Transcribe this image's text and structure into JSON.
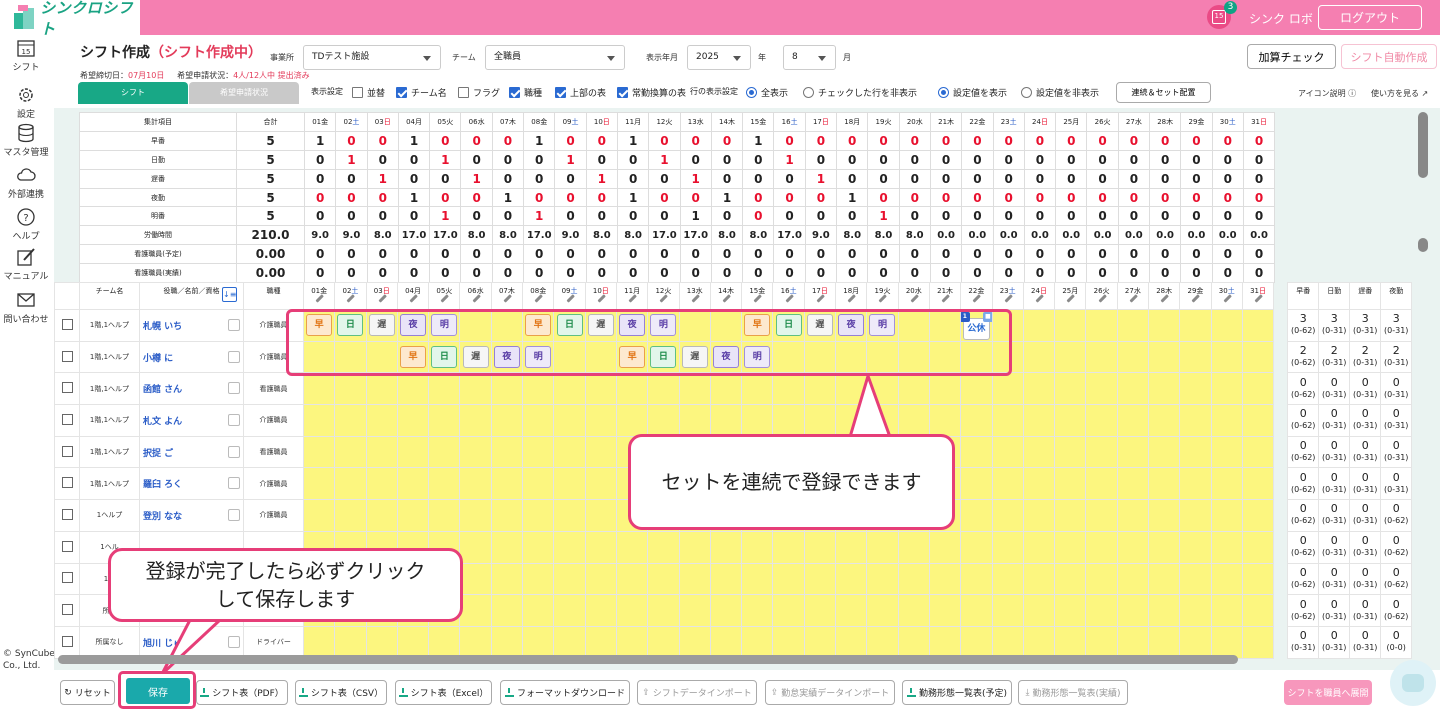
{
  "header": {
    "logo": "シンクロシフト",
    "notification_count": "3",
    "calendar_day": "15",
    "user": "シンク ロボ",
    "logout": "ログアウト"
  },
  "sidebar": [
    {
      "label": "シフト",
      "icon": "calendar-icon"
    },
    {
      "label": "設定",
      "icon": "gear-icon"
    },
    {
      "label": "マスタ管理",
      "icon": "database-icon"
    },
    {
      "label": "外部連携",
      "icon": "cloud-icon"
    },
    {
      "label": "ヘルプ",
      "icon": "help-icon"
    },
    {
      "label": "マニュアル",
      "icon": "edit-icon"
    },
    {
      "label": "問い合わせ",
      "icon": "mail-icon"
    }
  ],
  "copyright": [
    "© SynCube",
    "Co., Ltd."
  ],
  "page": {
    "title": "シフト作成",
    "mode": "（シフト作成中）",
    "deadline_label": "希望締切日：",
    "deadline_value": "07月10日",
    "apply_label": "希望申請状況：",
    "apply_value": "4人/12人中 提出済み"
  },
  "filters": {
    "facility_label": "事業所",
    "facility": "TDテスト施設",
    "team_label": "チーム",
    "team": "全職員",
    "period_label": "表示年月",
    "year": "2025",
    "year_unit": "年",
    "month": "8",
    "month_unit": "月"
  },
  "actions": {
    "calc_check": "加算チェック",
    "auto_create": "シフト自動作成"
  },
  "tabs": {
    "shift": "シフト",
    "request": "希望申請状況"
  },
  "display": {
    "label": "表示設定",
    "options": [
      {
        "label": "並替",
        "checked": false
      },
      {
        "label": "チーム名",
        "checked": true
      },
      {
        "label": "フラグ",
        "checked": false
      },
      {
        "label": "職種",
        "checked": true
      },
      {
        "label": "上部の表",
        "checked": true
      },
      {
        "label": "常勤換算の表",
        "checked": true
      }
    ],
    "row_label": "行の表示設定",
    "row_options": [
      {
        "label": "全表示",
        "checked": true
      },
      {
        "label": "チェックした行を非表示",
        "checked": false
      }
    ],
    "value_options": [
      {
        "label": "設定値を表示",
        "checked": true
      },
      {
        "label": "設定値を非表示",
        "checked": false
      }
    ],
    "chain_button": "連続＆セット配置",
    "icon_help": "アイコン説明",
    "how_to": "使い方を見る"
  },
  "days": [
    {
      "n": "01",
      "w": "金"
    },
    {
      "n": "02",
      "w": "土"
    },
    {
      "n": "03",
      "w": "日"
    },
    {
      "n": "04",
      "w": "月"
    },
    {
      "n": "05",
      "w": "火"
    },
    {
      "n": "06",
      "w": "水"
    },
    {
      "n": "07",
      "w": "木"
    },
    {
      "n": "08",
      "w": "金"
    },
    {
      "n": "09",
      "w": "土"
    },
    {
      "n": "10",
      "w": "日"
    },
    {
      "n": "11",
      "w": "月"
    },
    {
      "n": "12",
      "w": "火"
    },
    {
      "n": "13",
      "w": "水"
    },
    {
      "n": "14",
      "w": "木"
    },
    {
      "n": "15",
      "w": "金"
    },
    {
      "n": "16",
      "w": "土"
    },
    {
      "n": "17",
      "w": "日"
    },
    {
      "n": "18",
      "w": "月"
    },
    {
      "n": "19",
      "w": "火"
    },
    {
      "n": "20",
      "w": "水"
    },
    {
      "n": "21",
      "w": "木"
    },
    {
      "n": "22",
      "w": "金"
    },
    {
      "n": "23",
      "w": "土"
    },
    {
      "n": "24",
      "w": "日"
    },
    {
      "n": "25",
      "w": "月"
    },
    {
      "n": "26",
      "w": "火"
    },
    {
      "n": "27",
      "w": "水"
    },
    {
      "n": "28",
      "w": "木"
    },
    {
      "n": "29",
      "w": "金"
    },
    {
      "n": "30",
      "w": "土"
    },
    {
      "n": "31",
      "w": "日"
    }
  ],
  "summary": {
    "header_label": "集計項目",
    "total_label": "合計",
    "rows": [
      {
        "label": "早番",
        "total": "5",
        "type": "count",
        "values": [
          1,
          0,
          0,
          1,
          0,
          0,
          0,
          1,
          0,
          0,
          1,
          0,
          0,
          0,
          1,
          0,
          0,
          0,
          0,
          0,
          0,
          0,
          0,
          0,
          0,
          0,
          0,
          0,
          0,
          0,
          0
        ],
        "red": [
          2,
          3,
          5,
          6,
          7,
          9,
          10,
          12,
          13,
          14,
          16,
          17,
          18,
          19,
          20,
          21,
          22,
          23,
          24,
          25,
          26,
          27,
          28,
          29,
          30,
          31
        ]
      },
      {
        "label": "日勤",
        "total": "5",
        "type": "count",
        "values": [
          0,
          1,
          0,
          0,
          1,
          0,
          0,
          0,
          1,
          0,
          0,
          1,
          0,
          0,
          0,
          1,
          0,
          0,
          0,
          0,
          0,
          0,
          0,
          0,
          0,
          0,
          0,
          0,
          0,
          0,
          0
        ],
        "red": [
          2,
          5,
          9,
          12,
          16
        ]
      },
      {
        "label": "遅番",
        "total": "5",
        "type": "count",
        "values": [
          0,
          0,
          1,
          0,
          0,
          1,
          0,
          0,
          0,
          1,
          0,
          0,
          1,
          0,
          0,
          0,
          1,
          0,
          0,
          0,
          0,
          0,
          0,
          0,
          0,
          0,
          0,
          0,
          0,
          0,
          0
        ],
        "red": [
          3,
          6,
          10,
          13,
          17
        ]
      },
      {
        "label": "夜勤",
        "total": "5",
        "type": "count",
        "values": [
          0,
          0,
          0,
          1,
          0,
          0,
          1,
          0,
          0,
          0,
          1,
          0,
          0,
          1,
          0,
          0,
          0,
          1,
          0,
          0,
          0,
          0,
          0,
          0,
          0,
          0,
          0,
          0,
          0,
          0,
          0
        ],
        "red": [
          1,
          2,
          3,
          5,
          6,
          8,
          9,
          10,
          12,
          13,
          15,
          16,
          17,
          19,
          20,
          21,
          22,
          23,
          24,
          25,
          26,
          27,
          28,
          29,
          30,
          31
        ]
      },
      {
        "label": "明番",
        "total": "5",
        "type": "count",
        "values": [
          0,
          0,
          0,
          0,
          1,
          0,
          0,
          1,
          0,
          0,
          0,
          0,
          1,
          0,
          0,
          0,
          0,
          0,
          1,
          0,
          0,
          0,
          0,
          0,
          0,
          0,
          0,
          0,
          0,
          0,
          0
        ],
        "red": [
          5,
          8,
          15,
          19
        ]
      },
      {
        "label": "労働時間",
        "total": "210.0",
        "type": "hours",
        "values": [
          "9.0",
          "9.0",
          "8.0",
          "17.0",
          "17.0",
          "8.0",
          "8.0",
          "17.0",
          "9.0",
          "8.0",
          "8.0",
          "17.0",
          "17.0",
          "8.0",
          "8.0",
          "17.0",
          "9.0",
          "8.0",
          "8.0",
          "8.0",
          "0.0",
          "0.0",
          "0.0",
          "0.0",
          "0.0",
          "0.0",
          "0.0",
          "0.0",
          "0.0",
          "0.0",
          "0.0"
        ],
        "red": []
      },
      {
        "label": "看護職員(予定)",
        "total": "0.00",
        "type": "count",
        "values": [
          0,
          0,
          0,
          0,
          0,
          0,
          0,
          0,
          0,
          0,
          0,
          0,
          0,
          0,
          0,
          0,
          0,
          0,
          0,
          0,
          0,
          0,
          0,
          0,
          0,
          0,
          0,
          0,
          0,
          0,
          0
        ],
        "red": []
      },
      {
        "label": "看護職員(実績)",
        "total": "0.00",
        "type": "count",
        "values": [
          0,
          0,
          0,
          0,
          0,
          0,
          0,
          0,
          0,
          0,
          0,
          0,
          0,
          0,
          0,
          0,
          0,
          0,
          0,
          0,
          0,
          0,
          0,
          0,
          0,
          0,
          0,
          0,
          0,
          0,
          0
        ],
        "red": []
      }
    ]
  },
  "staff_header": {
    "team": "チーム名",
    "name": "役職／名前／資格",
    "job": "職種",
    "counts": [
      "早番",
      "日勤",
      "遅番",
      "夜勤"
    ]
  },
  "staff": [
    {
      "team": "1階,1ヘルプ",
      "name": "札幌 いち",
      "job": "介護職員",
      "shifts": {
        "1": "早",
        "2": "日",
        "3": "遅",
        "4": "夜",
        "5": "明",
        "8": "早",
        "9": "日",
        "10": "遅",
        "11": "夜",
        "12": "明",
        "15": "早",
        "16": "日",
        "17": "遅",
        "18": "夜",
        "19": "明",
        "22": "公休"
      },
      "counts": [
        [
          "3",
          "(0-62)"
        ],
        [
          "3",
          "(0-31)"
        ],
        [
          "3",
          "(0-31)"
        ],
        [
          "3",
          "(0-31)"
        ]
      ]
    },
    {
      "team": "1階,1ヘルプ",
      "name": "小樽 に",
      "job": "介護職員",
      "shifts": {
        "4": "早",
        "5": "日",
        "6": "遅",
        "7": "夜",
        "8": "明",
        "11": "早",
        "12": "日",
        "13": "遅",
        "14": "夜",
        "15": "明"
      },
      "counts": [
        [
          "2",
          "(0-62)"
        ],
        [
          "2",
          "(0-31)"
        ],
        [
          "2",
          "(0-31)"
        ],
        [
          "2",
          "(0-31)"
        ]
      ]
    },
    {
      "team": "1階,1ヘルプ",
      "name": "函館 さん",
      "job": "看護職員",
      "shifts": {},
      "counts": [
        [
          "0",
          "(0-62)"
        ],
        [
          "0",
          "(0-31)"
        ],
        [
          "0",
          "(0-31)"
        ],
        [
          "0",
          "(0-31)"
        ]
      ]
    },
    {
      "team": "1階,1ヘルプ",
      "name": "札文 よん",
      "job": "介護職員",
      "shifts": {},
      "counts": [
        [
          "0",
          "(0-62)"
        ],
        [
          "0",
          "(0-31)"
        ],
        [
          "0",
          "(0-31)"
        ],
        [
          "0",
          "(0-31)"
        ]
      ]
    },
    {
      "team": "1階,1ヘルプ",
      "name": "択捉 ご",
      "job": "看護職員",
      "shifts": {},
      "counts": [
        [
          "0",
          "(0-62)"
        ],
        [
          "0",
          "(0-31)"
        ],
        [
          "0",
          "(0-31)"
        ],
        [
          "0",
          "(0-31)"
        ]
      ]
    },
    {
      "team": "1階,1ヘルプ",
      "name": "羅臼 ろく",
      "job": "介護職員",
      "shifts": {},
      "counts": [
        [
          "0",
          "(0-62)"
        ],
        [
          "0",
          "(0-31)"
        ],
        [
          "0",
          "(0-31)"
        ],
        [
          "0",
          "(0-31)"
        ]
      ]
    },
    {
      "team": "1ヘルプ",
      "name": "登別 なな",
      "job": "介護職員",
      "shifts": {},
      "counts": [
        [
          "0",
          "(0-62)"
        ],
        [
          "0",
          "(0-31)"
        ],
        [
          "0",
          "(0-31)"
        ],
        [
          "0",
          "(0-62)"
        ]
      ]
    },
    {
      "team": "1ヘル",
      "name": "",
      "job": "",
      "shifts": {},
      "counts": [
        [
          "0",
          "(0-62)"
        ],
        [
          "0",
          "(0-31)"
        ],
        [
          "0",
          "(0-31)"
        ],
        [
          "0",
          "(0-62)"
        ]
      ]
    },
    {
      "team": "1ヘ",
      "name": "",
      "job": "",
      "shifts": {},
      "counts": [
        [
          "0",
          "(0-62)"
        ],
        [
          "0",
          "(0-31)"
        ],
        [
          "0",
          "(0-31)"
        ],
        [
          "0",
          "(0-62)"
        ]
      ]
    },
    {
      "team": "所属",
      "name": "",
      "job": "",
      "shifts": {},
      "counts": [
        [
          "0",
          "(0-62)"
        ],
        [
          "0",
          "(0-31)"
        ],
        [
          "0",
          "(0-31)"
        ],
        [
          "0",
          "(0-62)"
        ]
      ]
    },
    {
      "team": "所属なし",
      "name": "旭川 じゅ",
      "job": "ドライバー",
      "shifts": {},
      "counts": [
        [
          "0",
          "(0-31)"
        ],
        [
          "0",
          "(0-31)"
        ],
        [
          "0",
          "(0-31)"
        ],
        [
          "0",
          "(0-0)"
        ]
      ]
    }
  ],
  "callouts": {
    "continuous": "セットを連続で登録できます",
    "save_1": "登録が完了したら必ずクリック",
    "save_2": "して保存します"
  },
  "footer": {
    "reset": "リセット",
    "save": "保存",
    "pdf": "シフト表（PDF）",
    "csv": "シフト表（CSV）",
    "excel": "シフト表（Excel）",
    "format_dl": "フォーマットダウンロード",
    "import": "シフトデータインポート",
    "actual_import": "勤怠実績データインポート",
    "list_plan": "勤務形態一覧表(予定)",
    "list_actual": "勤務形態一覧表(実績)",
    "deploy": "シフトを職員へ展開"
  },
  "colors": {
    "brand_pink": "#f57fb1",
    "brand_green": "#18a886",
    "highlight": "#e63e78",
    "day_cell": "#fcf67f"
  }
}
